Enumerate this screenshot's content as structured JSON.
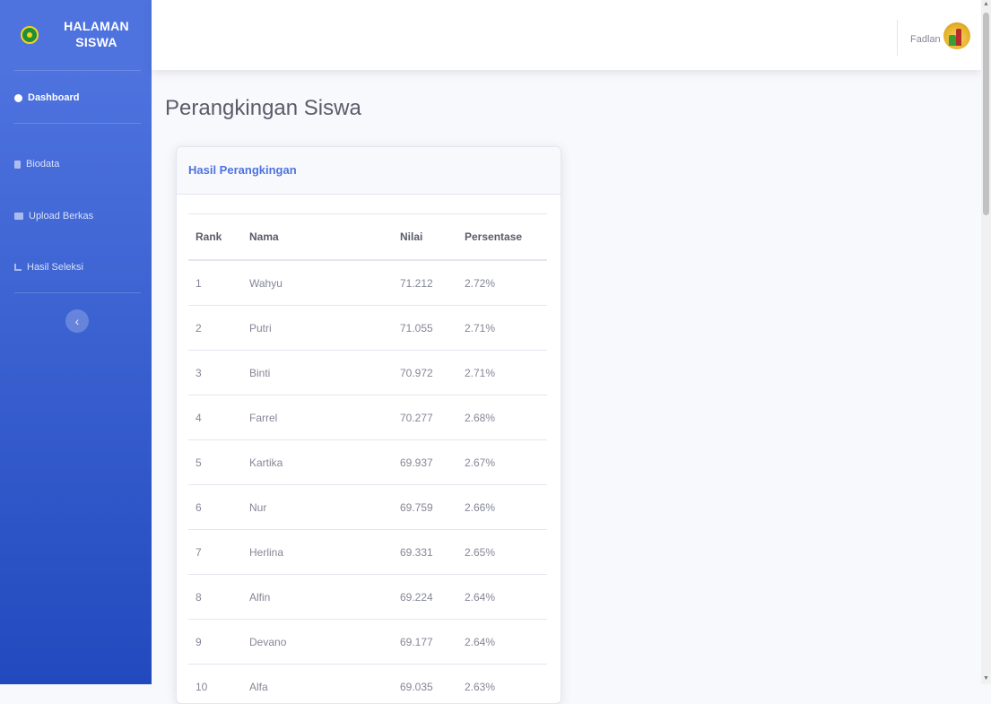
{
  "sidebar": {
    "brand": "HALAMAN SISWA",
    "items": [
      {
        "label": "Dashboard",
        "icon": "dashboard-icon"
      },
      {
        "label": "Biodata",
        "icon": "file-icon"
      },
      {
        "label": "Upload Berkas",
        "icon": "folder-icon"
      },
      {
        "label": "Hasil Seleksi",
        "icon": "chart-icon"
      }
    ],
    "toggle": "‹"
  },
  "topbar": {
    "user_name": "Fadlan"
  },
  "page": {
    "title": "Perangkingan Siswa"
  },
  "card": {
    "title": "Hasil Perangkingan"
  },
  "table": {
    "headers": [
      "Rank",
      "Nama",
      "Nilai",
      "Persentase"
    ],
    "rows": [
      [
        "1",
        "Wahyu",
        "71.212",
        "2.72%"
      ],
      [
        "2",
        "Putri",
        "71.055",
        "2.71%"
      ],
      [
        "3",
        "Binti",
        "70.972",
        "2.71%"
      ],
      [
        "4",
        "Farrel",
        "70.277",
        "2.68%"
      ],
      [
        "5",
        "Kartika",
        "69.937",
        "2.67%"
      ],
      [
        "6",
        "Nur",
        "69.759",
        "2.66%"
      ],
      [
        "7",
        "Herlina",
        "69.331",
        "2.65%"
      ],
      [
        "8",
        "Alfin",
        "69.224",
        "2.64%"
      ],
      [
        "9",
        "Devano",
        "69.177",
        "2.64%"
      ],
      [
        "10",
        "Alfa",
        "69.035",
        "2.63%"
      ]
    ]
  },
  "colors": {
    "primary": "#4e73df",
    "sidebar_end": "#224abe",
    "text": "#5a5c69",
    "muted": "#858796"
  }
}
